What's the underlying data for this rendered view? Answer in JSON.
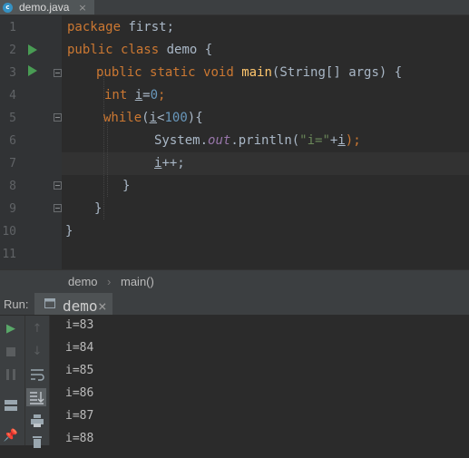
{
  "editor_tab": {
    "filename": "demo.java",
    "close": "×"
  },
  "gutter": {
    "line_numbers": [
      "1",
      "2",
      "3",
      "4",
      "5",
      "6",
      "7",
      "8",
      "9",
      "10",
      "11"
    ]
  },
  "code": {
    "l1": {
      "kw": "package",
      "rest": " first;"
    },
    "l2": {
      "kw1": "public",
      "kw2": "class",
      "rest": " demo {"
    },
    "l3": {
      "kw1": "public",
      "kw2": "static",
      "kw3": "void",
      "method": "main",
      "rest": "(String[] args) {"
    },
    "l4": {
      "kw": "int",
      "var": "i",
      "eq": "=",
      "num": "0",
      "semi": ";"
    },
    "l5": {
      "kw": "while",
      "open": "(",
      "var": "i",
      "lt": "<",
      "num": "100",
      "close": "){"
    },
    "l6": {
      "obj": "System.",
      "field": "out",
      "call": ".println(",
      "str": "\"i=\"",
      "plus": "+",
      "var": "i",
      "end": ");"
    },
    "l7": {
      "var": "i",
      "rest": "++;"
    },
    "l8": "}",
    "l9": "}",
    "l10": "}"
  },
  "breadcrumb": {
    "class": "demo",
    "sep": "›",
    "method": "main()"
  },
  "run_panel": {
    "label": "Run:",
    "tab_label": "demo",
    "tab_close": "×",
    "output": [
      "i=83",
      "i=84",
      "i=85",
      "i=86",
      "i=87",
      "i=88"
    ]
  },
  "colors": {
    "run_green": "#499c54",
    "keyword": "#cc7832",
    "method": "#ffc66d",
    "number": "#6897bb",
    "string": "#6a8759",
    "field": "#9876aa"
  },
  "icons": [
    "java-file-icon",
    "run-gutter-icon",
    "fold-icon",
    "rerun-icon",
    "stop-icon",
    "pause-icon",
    "layout-icon",
    "pin-icon",
    "scroll-up-icon",
    "scroll-down-icon",
    "soft-wrap-icon",
    "scroll-to-end-icon",
    "print-icon",
    "delete-icon"
  ]
}
